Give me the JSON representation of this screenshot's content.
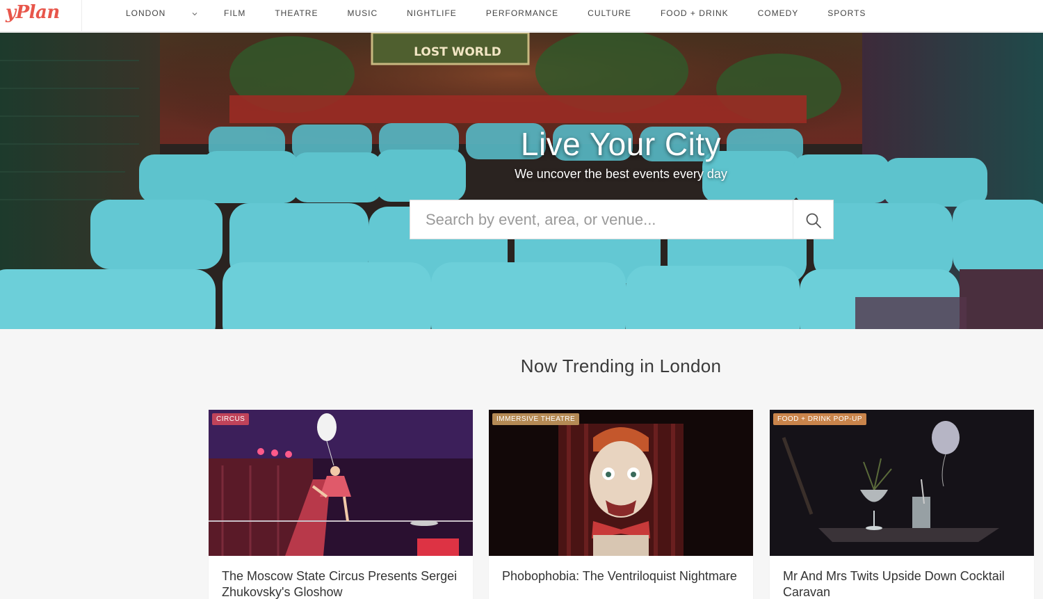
{
  "brand": {
    "logo_text": "yPlan",
    "color": "#e8564b"
  },
  "nav": {
    "city": "LONDON",
    "city_icon": "chevron-down-icon",
    "items": [
      "FILM",
      "THEATRE",
      "MUSIC",
      "NIGHTLIFE",
      "PERFORMANCE",
      "CULTURE",
      "FOOD + DRINK",
      "COMEDY",
      "SPORTS"
    ]
  },
  "hero": {
    "title": "Live Your City",
    "subtitle": "We uncover the best events every day",
    "screen_sign": "LOST WORLD",
    "search_placeholder": "Search by event, area, or venue...",
    "search_icon": "search-icon"
  },
  "trending": {
    "heading": "Now Trending in London",
    "cards": [
      {
        "badge": "CIRCUS",
        "badge_color": "#c0435a",
        "title": "The Moscow State Circus Presents Sergei Zhukovsky's Gloshow"
      },
      {
        "badge": "IMMERSIVE THEATRE",
        "badge_color": "#b58a55",
        "title": "Phobophobia: The Ventriloquist Nightmare"
      },
      {
        "badge": "FOOD + DRINK POP-UP",
        "badge_color": "#c9844b",
        "title": "Mr And Mrs Twits Upside Down Cocktail Caravan"
      }
    ]
  }
}
